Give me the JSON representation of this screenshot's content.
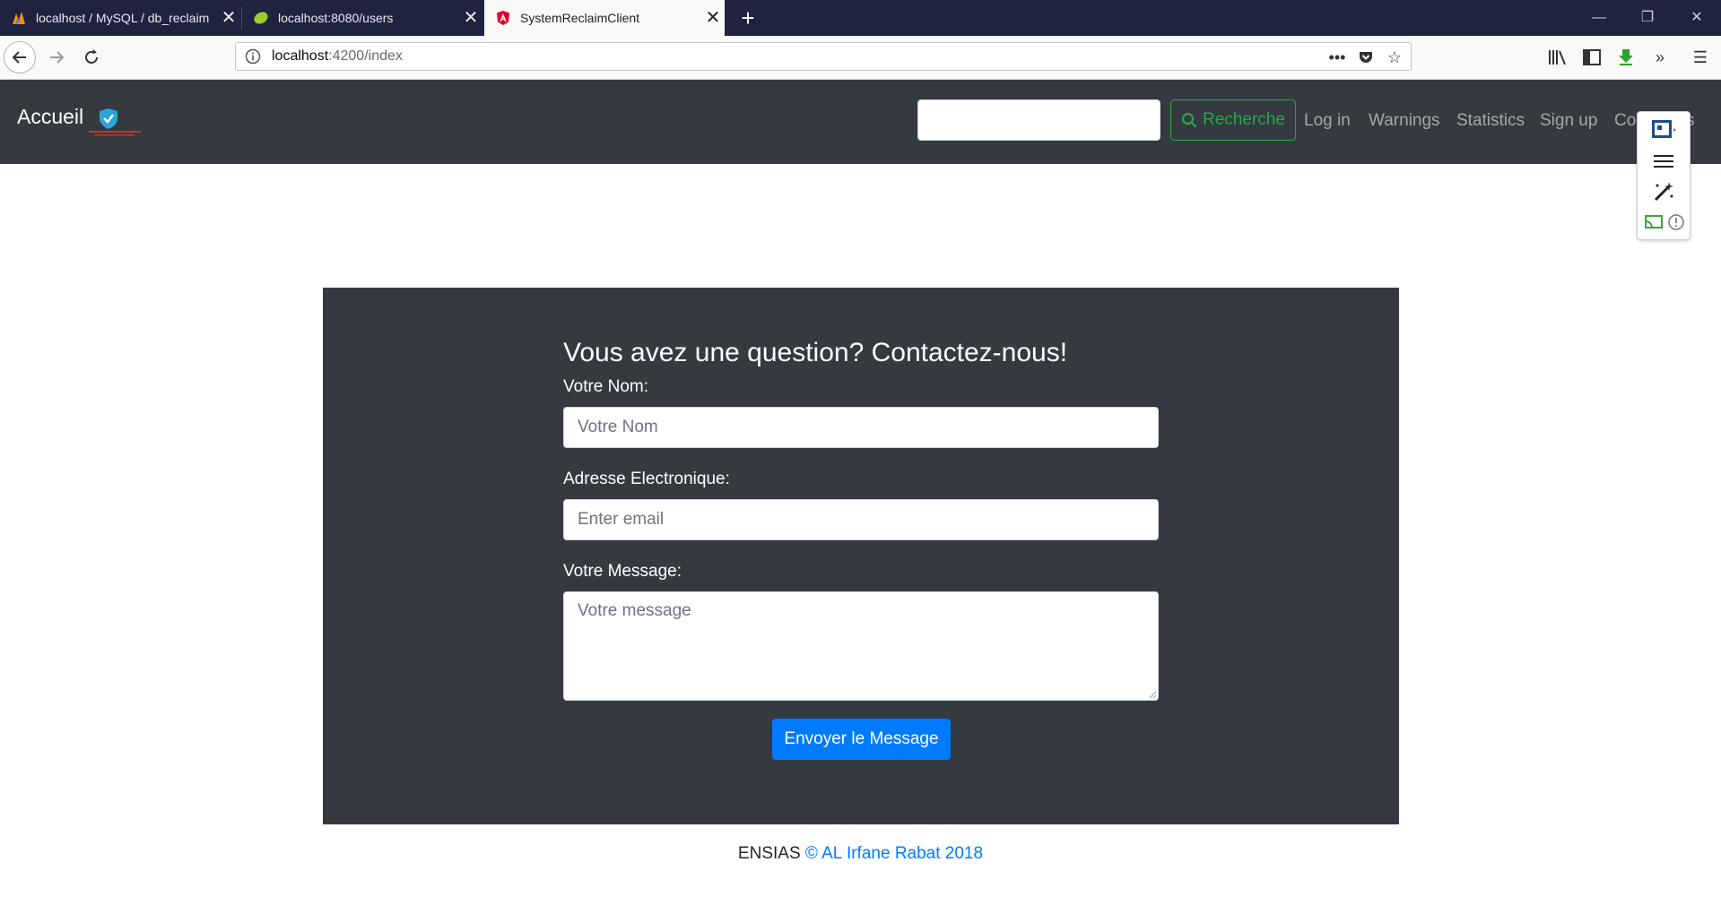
{
  "browser": {
    "tabs": [
      {
        "title": "localhost / MySQL / db_reclaim",
        "icon": "phpmyadmin-icon",
        "active": false
      },
      {
        "title": "localhost:8080/users",
        "icon": "spring-leaf-icon",
        "active": false
      },
      {
        "title": "SystemReclaimClient",
        "icon": "angular-icon",
        "active": true
      }
    ],
    "new_tab": "+",
    "url_host": "localhost",
    "url_path": ":4200/index"
  },
  "navbar": {
    "brand": "Accueil",
    "search_placeholder": "",
    "search_button": "Recherche",
    "links": [
      "Log in",
      "Warnings",
      "Statistics",
      "Sign up",
      "Co",
      "s"
    ]
  },
  "contact": {
    "title": "Vous avez une question? Contactez-nous!",
    "name_label": "Votre Nom:",
    "name_placeholder": "Votre Nom",
    "email_label": "Adresse Electronique:",
    "email_placeholder": "Enter email",
    "message_label": "Votre Message:",
    "message_placeholder": "Votre message",
    "submit": "Envoyer le Message"
  },
  "footer": {
    "prefix": "ENSIAS",
    "link": "© AL Irfane Rabat 2018"
  },
  "colors": {
    "navbar_bg": "#343a40",
    "success": "#28a745",
    "primary": "#007bff",
    "tabbar_bg": "#202340"
  }
}
